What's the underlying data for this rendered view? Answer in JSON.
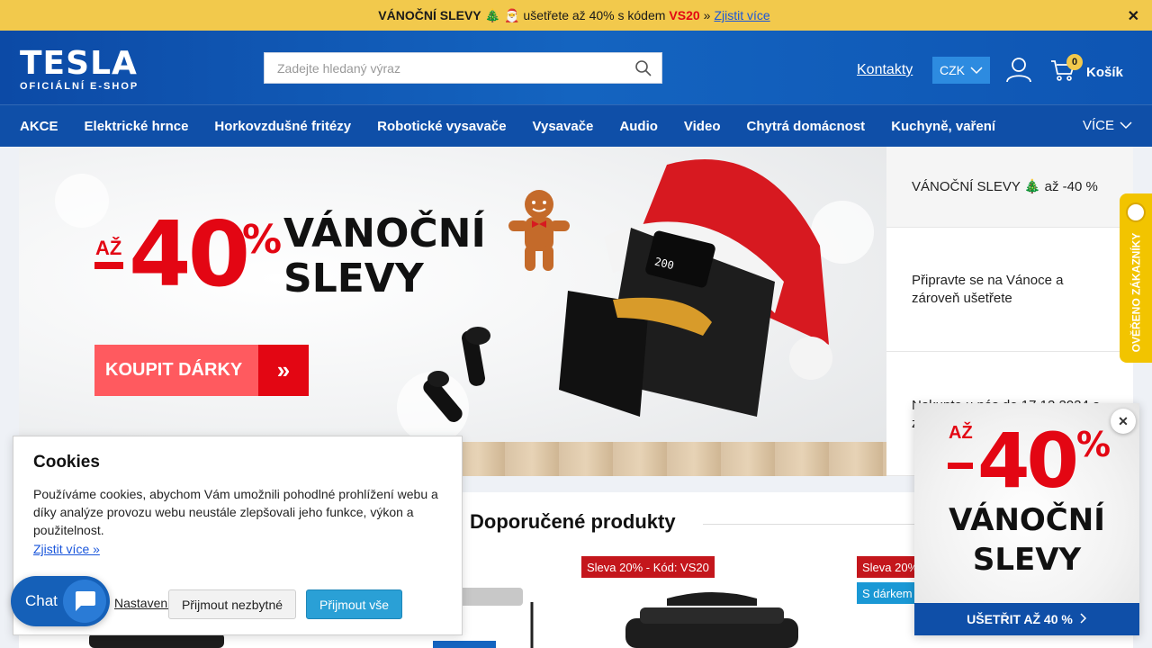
{
  "promo": {
    "title": "VÁNOČNÍ SLEVY",
    "emoji": "🎄 🎅",
    "text_before": "ušetřete až 40% s kódem",
    "code": "VS20",
    "sep": "»",
    "link": "Zjistit více",
    "close": "✕"
  },
  "header": {
    "logo": "TESLA",
    "logo_sub": "OFICIÁLNÍ E-SHOP",
    "search_placeholder": "Zadejte hledaný výraz",
    "contacts": "Kontakty",
    "currency": "CZK",
    "cart_count": "0",
    "cart_label": "Košík"
  },
  "nav": {
    "items": [
      "AKCE",
      "Elektrické hrnce",
      "Horkovzdušné fritézy",
      "Robotické vysavače",
      "Vysavače",
      "Audio",
      "Video",
      "Chytrá domácnost",
      "Kuchyně, vaření"
    ],
    "more": "VÍCE"
  },
  "hero": {
    "az": "AŽ",
    "discount": "40",
    "pct": "%",
    "title_line1": "VÁNOČNÍ",
    "title_line2": "SLEVY",
    "cta": "KOUPIT DÁRKY",
    "cta_arrow": "»",
    "air_fryer_display": "200"
  },
  "side_panel": {
    "items": [
      "VÁNOČNÍ SLEVY 🎄 až -40 %",
      "Připravte se na Vánoce a zároveň ušetřete",
      "Nakupte u nás do 17.12.2024 a z"
    ]
  },
  "verified": {
    "text": "OVĚŘENO ZÁKAZNÍKY"
  },
  "recommended": {
    "heading": "Doporučené produkty",
    "tags": [
      "Sleva 20% - Kód: VS20",
      "Sleva 20%",
      "S dárkem"
    ]
  },
  "cookies": {
    "title": "Cookies",
    "text": "Používáme cookies, abychom Vám umožnili pohodlné prohlížení webu a díky analýze provozu webu neustále zlepšovali jeho funkce, výkon a použitelnost.",
    "more": "Zjistit více »",
    "settings": "Nastavení",
    "necessary": "Přijmout nezbytné",
    "all": "Přijmout vše"
  },
  "chat": {
    "label": "Chat"
  },
  "popup": {
    "az": "AŽ",
    "discount": "40",
    "pct": "%",
    "line1": "VÁNOČNÍ",
    "line2": "SLEVY",
    "cta": "UŠETŘIT AŽ 40 %",
    "close": "✕"
  },
  "colors": {
    "brand_blue": "#0f4fa8",
    "promo_yellow": "#f2c94c",
    "accent_red": "#e30613",
    "accept_blue": "#2aa0d6"
  }
}
